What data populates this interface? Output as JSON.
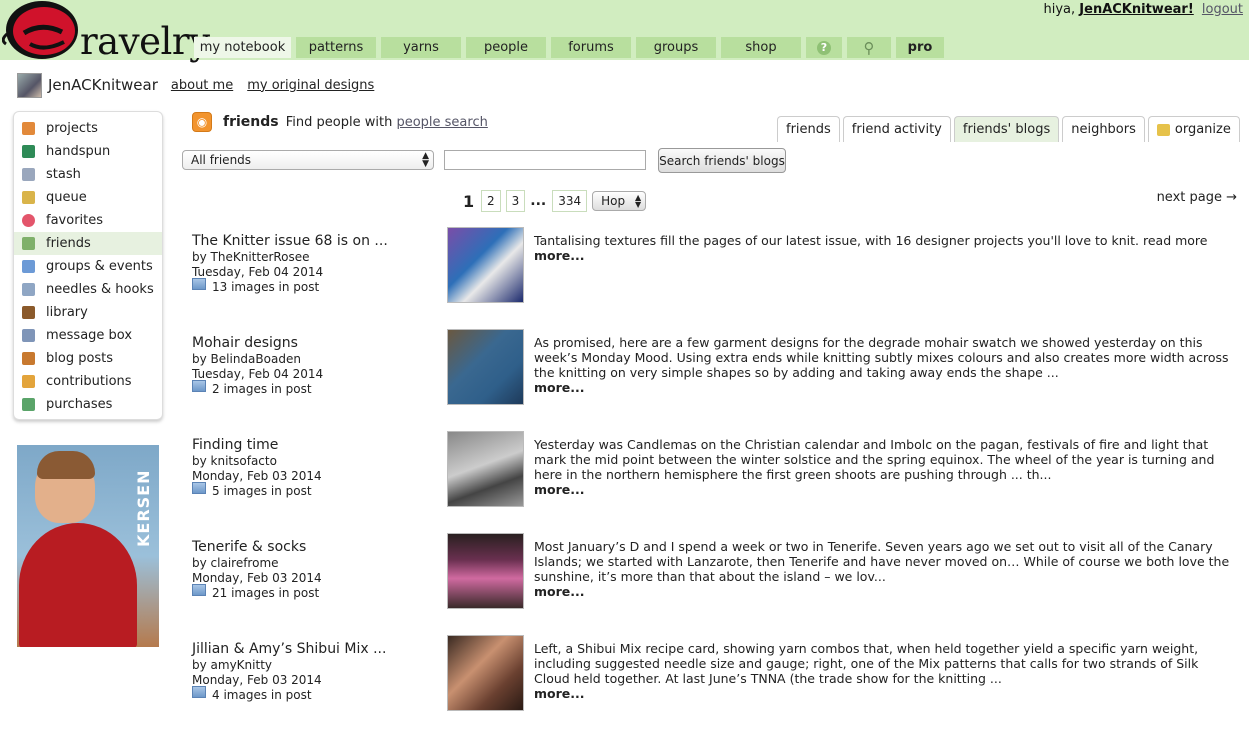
{
  "header": {
    "logo_text": "ravelry",
    "greeting": "hiya,",
    "username": "JenACKnitwear!",
    "logout_label": "logout"
  },
  "nav": [
    {
      "label": "my notebook",
      "width": 97
    },
    {
      "label": "patterns",
      "width": 80
    },
    {
      "label": "yarns",
      "width": 80
    },
    {
      "label": "people",
      "width": 80
    },
    {
      "label": "forums",
      "width": 80
    },
    {
      "label": "groups",
      "width": 80
    },
    {
      "label": "shop",
      "width": 80
    }
  ],
  "nav_extra": {
    "help_icon": "?",
    "search_icon": "⚲",
    "pro": "pro"
  },
  "profile": {
    "name": "JenACKnitwear",
    "about": "about me",
    "designs": "my original designs"
  },
  "sidebar": {
    "items": [
      {
        "label": "projects",
        "icon": "grid-icon",
        "color": "#e2893a"
      },
      {
        "label": "handspun",
        "icon": "spool-icon",
        "color": "#2e8b57"
      },
      {
        "label": "stash",
        "icon": "basket-icon",
        "color": "#9aa7bd"
      },
      {
        "label": "queue",
        "icon": "queue-icon",
        "color": "#d9b44a"
      },
      {
        "label": "favorites",
        "icon": "heart-icon",
        "color": "#e3556b"
      },
      {
        "label": "friends",
        "icon": "friends-icon",
        "color": "#7fb06a"
      },
      {
        "label": "groups & events",
        "icon": "groups-icon",
        "color": "#6c9ad6"
      },
      {
        "label": "needles & hooks",
        "icon": "needles-icon",
        "color": "#8fa6c4"
      },
      {
        "label": "library",
        "icon": "books-icon",
        "color": "#8b5a2b"
      },
      {
        "label": "message box",
        "icon": "envelope-icon",
        "color": "#7f95b8"
      },
      {
        "label": "blog posts",
        "icon": "house-icon",
        "color": "#c8792f"
      },
      {
        "label": "contributions",
        "icon": "pencil-icon",
        "color": "#e3a43b"
      },
      {
        "label": "purchases",
        "icon": "tag-icon",
        "color": "#5aa469"
      }
    ]
  },
  "ad": {
    "brand": "KERSEN"
  },
  "main": {
    "title": "friends",
    "find_text": "Find people with",
    "people_search": "people search",
    "subtabs": [
      "friends",
      "friend activity",
      "friends' blogs",
      "neighbors",
      "organize"
    ],
    "filter_selected": "All friends",
    "search_button": "Search friends' blogs",
    "pagination": {
      "current": "1",
      "pages": [
        "2",
        "3",
        "334"
      ],
      "ellipsis": "...",
      "hop": "Hop",
      "next": "next page →"
    }
  },
  "posts": [
    {
      "title": "The Knitter issue 68 is on ...",
      "by": "by TheKnitterRosee",
      "date": "Tuesday, Feb 04 2014",
      "images": "13 images in post",
      "text": "Tantalising textures fill the pages of our latest issue, with 16 designer projects you'll love to knit.    read more",
      "more": "more...",
      "thumb": "linear-gradient(135deg,#7a4da8 0%,#2d6fb8 40%,#e8e8e8 60%,#1c2a6e 100%)"
    },
    {
      "title": "Mohair designs",
      "by": "by BelindaBoaden",
      "date": "Tuesday, Feb 04 2014",
      "images": "2 images in post",
      "text": "As promised, here are a few garment designs for the degrade mohair swatch we showed yesterday on this week’s Monday Mood. Using extra ends while knitting subtly mixes colours and also creates more width across the knitting on very simple shapes so by adding and taking away ends the shape ...",
      "more": "more...",
      "thumb": "linear-gradient(135deg,#6a5840 0%,#3a6890 40%,#2f5f8a 70%,#1e3a5a 100%)"
    },
    {
      "title": "Finding time",
      "by": "by knitsofacto",
      "date": "Monday, Feb 03 2014",
      "images": "5 images in post",
      "text": "Yesterday was Candlemas on the Christian calendar and Imbolc on the pagan, festivals of fire and light that mark the mid point between the winter solstice and the spring equinox. The wheel of the year is turning and here in the northern hemisphere the first green shoots are pushing through ... th...",
      "more": "more...",
      "thumb": "linear-gradient(160deg,#888 0%,#ccc 45%,#444 70%,#999 100%)"
    },
    {
      "title": "Tenerife & socks",
      "by": "by clairefrome",
      "date": "Monday, Feb 03 2014",
      "images": "21 images in post",
      "text": "Most January’s D and I spend a week or two in Tenerife. Seven years ago we set out to visit all of the Canary Islands; we started with Lanzarote, then Tenerife and have never moved on… While of course we both love the sunshine, it’s more than that about the island – we lov...",
      "more": "more...",
      "thumb": "linear-gradient(180deg,#2a2020 0%,#6a3050 35%,#d06aa0 60%,#3a2a2a 100%)"
    },
    {
      "title": "Jillian & Amy’s Shibui Mix ...",
      "by": "by amyKnitty",
      "date": "Monday, Feb 03 2014",
      "images": "4 images in post",
      "text": "Left, a Shibui Mix recipe card, showing yarn combos that, when held together yield a specific yarn weight, including suggested needle size and gauge; right, one of the Mix patterns that calls for two strands of Silk Cloud held together. At last June’s TNNA (the trade show for the knitting ...",
      "more": "more...",
      "thumb": "linear-gradient(135deg,#3a2a22 0%,#c89070 40%,#6a4030 70%,#2a1a14 100%)"
    }
  ]
}
